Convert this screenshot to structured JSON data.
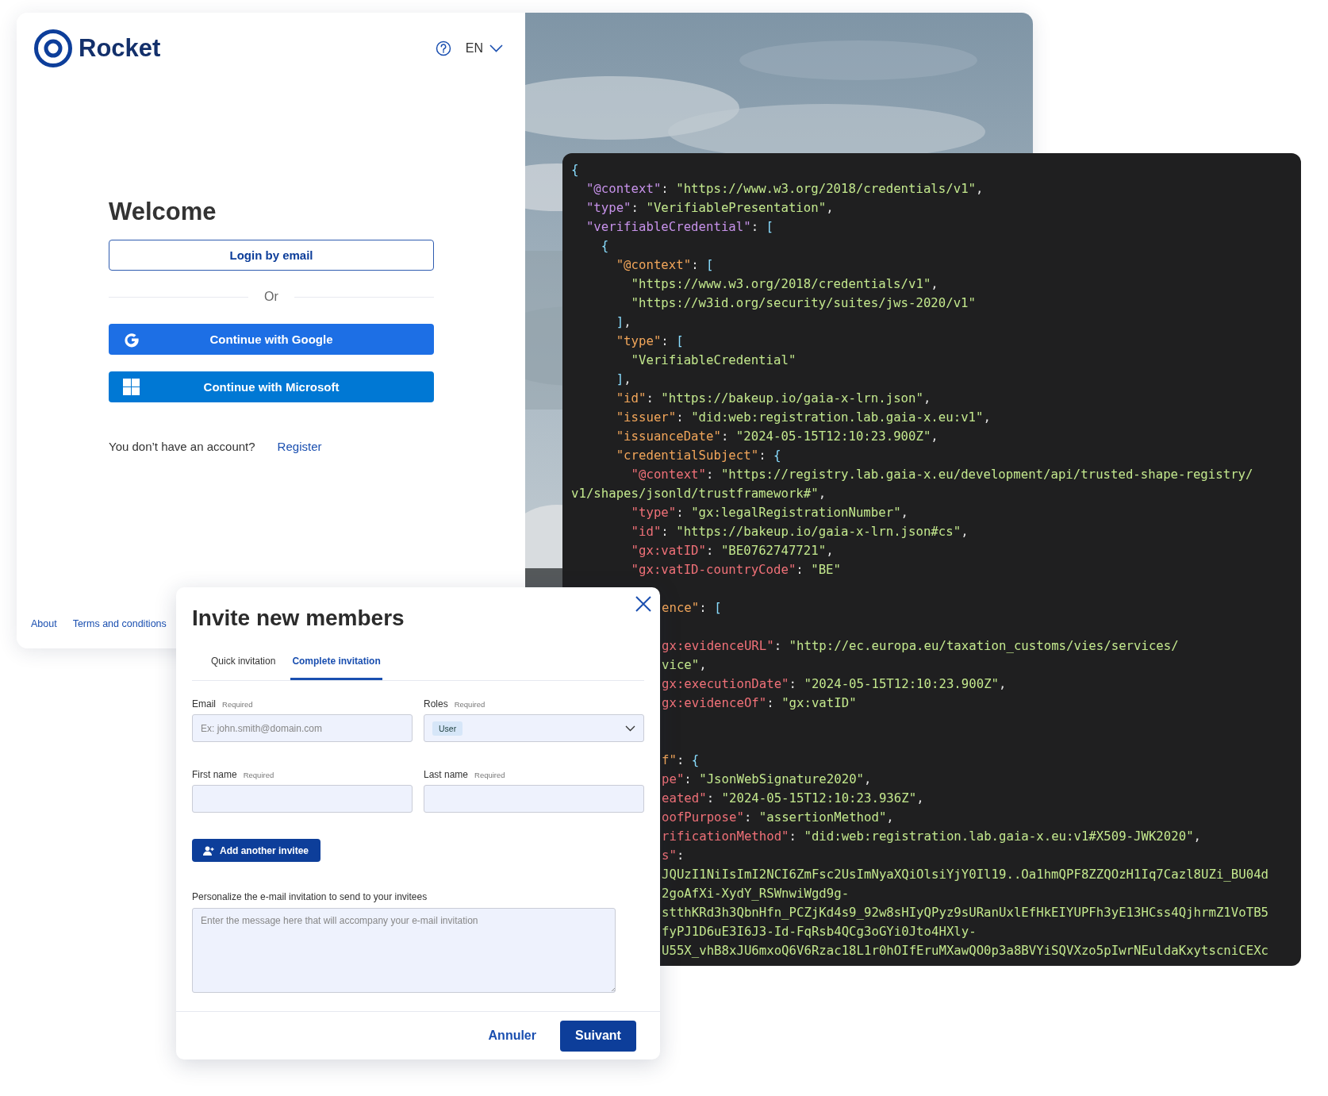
{
  "login": {
    "brand": "Rocket",
    "language": "EN",
    "title": "Welcome",
    "email_button": "Login by email",
    "divider": "Or",
    "providers": [
      {
        "kind": "google",
        "label": "Continue with Google"
      },
      {
        "kind": "microsoft",
        "label": "Continue with Microsoft"
      }
    ],
    "register_prompt": "You don’t have an account?",
    "register_link": "Register",
    "footer_links": [
      "About",
      "Terms and conditions"
    ],
    "background": {
      "kind": "picture"
    }
  },
  "code": {
    "lines": [
      {
        "kind": "text",
        "tokens": [
          {
            "text": "{",
            "color": "#89ddff"
          }
        ]
      },
      {
        "kind": "text",
        "tokens": [
          {
            "text": "  \"@context\"",
            "color": "#c792ea"
          },
          {
            "text": ": ",
            "color": "#e4e4e4"
          },
          {
            "text": "\"https://www.w3.org/2018/credentials/v1\"",
            "color": "#c3e88d"
          },
          {
            "text": ",",
            "color": "#e4e4e4"
          }
        ]
      },
      {
        "kind": "text",
        "tokens": [
          {
            "text": "  \"type\"",
            "color": "#c792ea"
          },
          {
            "text": ": ",
            "color": "#e4e4e4"
          },
          {
            "text": "\"VerifiablePresentation\"",
            "color": "#c3e88d"
          },
          {
            "text": ",",
            "color": "#e4e4e4"
          }
        ]
      },
      {
        "kind": "text",
        "tokens": [
          {
            "text": "  \"verifiableCredential\"",
            "color": "#c792ea"
          },
          {
            "text": ": ",
            "color": "#e4e4e4"
          },
          {
            "text": "[",
            "color": "#89ddff"
          }
        ]
      },
      {
        "kind": "text",
        "tokens": [
          {
            "text": "    {",
            "color": "#89ddff"
          }
        ]
      },
      {
        "kind": "text",
        "tokens": [
          {
            "text": "      \"@context\"",
            "color": "#f2a65a"
          },
          {
            "text": ": ",
            "color": "#e4e4e4"
          },
          {
            "text": "[",
            "color": "#89ddff"
          }
        ]
      },
      {
        "kind": "text",
        "tokens": [
          {
            "text": "        \"https://www.w3.org/2018/credentials/v1\"",
            "color": "#c3e88d"
          },
          {
            "text": ",",
            "color": "#e4e4e4"
          }
        ]
      },
      {
        "kind": "text",
        "tokens": [
          {
            "text": "        \"https://w3id.org/security/suites/jws-2020/v1\"",
            "color": "#c3e88d"
          }
        ]
      },
      {
        "kind": "text",
        "tokens": [
          {
            "text": "      ]",
            "color": "#89ddff"
          },
          {
            "text": ",",
            "color": "#e4e4e4"
          }
        ]
      },
      {
        "kind": "text",
        "tokens": [
          {
            "text": "      \"type\"",
            "color": "#f2a65a"
          },
          {
            "text": ": ",
            "color": "#e4e4e4"
          },
          {
            "text": "[",
            "color": "#89ddff"
          }
        ]
      },
      {
        "kind": "text",
        "tokens": [
          {
            "text": "        \"VerifiableCredential\"",
            "color": "#c3e88d"
          }
        ]
      },
      {
        "kind": "text",
        "tokens": [
          {
            "text": "      ]",
            "color": "#89ddff"
          },
          {
            "text": ",",
            "color": "#e4e4e4"
          }
        ]
      },
      {
        "kind": "text",
        "tokens": [
          {
            "text": "      \"id\"",
            "color": "#f2a65a"
          },
          {
            "text": ": ",
            "color": "#e4e4e4"
          },
          {
            "text": "\"https://bakeup.io/gaia-x-lrn.json\"",
            "color": "#c3e88d"
          },
          {
            "text": ",",
            "color": "#e4e4e4"
          }
        ]
      },
      {
        "kind": "text",
        "tokens": [
          {
            "text": "      \"issuer\"",
            "color": "#f2a65a"
          },
          {
            "text": ": ",
            "color": "#e4e4e4"
          },
          {
            "text": "\"did:web:registration.lab.gaia-x.eu:v1\"",
            "color": "#c3e88d"
          },
          {
            "text": ",",
            "color": "#e4e4e4"
          }
        ]
      },
      {
        "kind": "text",
        "tokens": [
          {
            "text": "      \"issuanceDate\"",
            "color": "#f2a65a"
          },
          {
            "text": ": ",
            "color": "#e4e4e4"
          },
          {
            "text": "\"2024-05-15T12:10:23.900Z\"",
            "color": "#c3e88d"
          },
          {
            "text": ",",
            "color": "#e4e4e4"
          }
        ]
      },
      {
        "kind": "text",
        "tokens": [
          {
            "text": "      \"credentialSubject\"",
            "color": "#f2a65a"
          },
          {
            "text": ": ",
            "color": "#e4e4e4"
          },
          {
            "text": "{",
            "color": "#89ddff"
          }
        ]
      },
      {
        "kind": "text",
        "tokens": [
          {
            "text": "        \"@context\"",
            "color": "#f07178"
          },
          {
            "text": ": ",
            "color": "#e4e4e4"
          },
          {
            "text": "\"https://registry.lab.gaia-x.eu/development/api/trusted-shape-registry/",
            "color": "#c3e88d"
          }
        ]
      },
      {
        "kind": "text",
        "tokens": [
          {
            "text": "v1/shapes/jsonld/trustframework#\"",
            "color": "#c3e88d"
          },
          {
            "text": ",",
            "color": "#e4e4e4"
          }
        ]
      },
      {
        "kind": "text",
        "tokens": [
          {
            "text": "        \"type\"",
            "color": "#f07178"
          },
          {
            "text": ": ",
            "color": "#e4e4e4"
          },
          {
            "text": "\"gx:legalRegistrationNumber\"",
            "color": "#c3e88d"
          },
          {
            "text": ",",
            "color": "#e4e4e4"
          }
        ]
      },
      {
        "kind": "text",
        "tokens": [
          {
            "text": "        \"id\"",
            "color": "#f07178"
          },
          {
            "text": ": ",
            "color": "#e4e4e4"
          },
          {
            "text": "\"https://bakeup.io/gaia-x-lrn.json#cs\"",
            "color": "#c3e88d"
          },
          {
            "text": ",",
            "color": "#e4e4e4"
          }
        ]
      },
      {
        "kind": "text",
        "tokens": [
          {
            "text": "        \"gx:vatID\"",
            "color": "#f07178"
          },
          {
            "text": ": ",
            "color": "#e4e4e4"
          },
          {
            "text": "\"BE0762747721\"",
            "color": "#c3e88d"
          },
          {
            "text": ",",
            "color": "#e4e4e4"
          }
        ]
      },
      {
        "kind": "text",
        "tokens": [
          {
            "text": "        \"gx:vatID-countryCode\"",
            "color": "#f07178"
          },
          {
            "text": ": ",
            "color": "#e4e4e4"
          },
          {
            "text": "\"BE\"",
            "color": "#c3e88d"
          }
        ]
      },
      {
        "kind": "covered"
      },
      {
        "kind": "cut",
        "tokens": [
          {
            "text": "ence\"",
            "color": "#f2a65a"
          },
          {
            "text": ": ",
            "color": "#e4e4e4"
          },
          {
            "text": "[",
            "color": "#89ddff"
          }
        ]
      },
      {
        "kind": "covered"
      },
      {
        "kind": "cut",
        "tokens": [
          {
            "text": "gx:evidenceURL\"",
            "color": "#f07178"
          },
          {
            "text": ": ",
            "color": "#e4e4e4"
          },
          {
            "text": "\"http://ec.europa.eu/taxation_customs/vies/services/",
            "color": "#c3e88d"
          }
        ]
      },
      {
        "kind": "cut",
        "tokens": [
          {
            "text": "vice\"",
            "color": "#c3e88d"
          },
          {
            "text": ",",
            "color": "#e4e4e4"
          }
        ]
      },
      {
        "kind": "cut",
        "tokens": [
          {
            "text": "gx:executionDate\"",
            "color": "#f07178"
          },
          {
            "text": ": ",
            "color": "#e4e4e4"
          },
          {
            "text": "\"2024-05-15T12:10:23.900Z\"",
            "color": "#c3e88d"
          },
          {
            "text": ",",
            "color": "#e4e4e4"
          }
        ]
      },
      {
        "kind": "cut",
        "tokens": [
          {
            "text": "gx:evidenceOf\"",
            "color": "#f07178"
          },
          {
            "text": ": ",
            "color": "#e4e4e4"
          },
          {
            "text": "\"gx:vatID\"",
            "color": "#c3e88d"
          }
        ]
      },
      {
        "kind": "covered"
      },
      {
        "kind": "covered"
      },
      {
        "kind": "cut",
        "tokens": [
          {
            "text": "f\"",
            "color": "#f2a65a"
          },
          {
            "text": ": ",
            "color": "#e4e4e4"
          },
          {
            "text": "{",
            "color": "#89ddff"
          }
        ]
      },
      {
        "kind": "cut",
        "tokens": [
          {
            "text": "pe\"",
            "color": "#f07178"
          },
          {
            "text": ": ",
            "color": "#e4e4e4"
          },
          {
            "text": "\"JsonWebSignature2020\"",
            "color": "#c3e88d"
          },
          {
            "text": ",",
            "color": "#e4e4e4"
          }
        ]
      },
      {
        "kind": "cut",
        "tokens": [
          {
            "text": "eated\"",
            "color": "#f07178"
          },
          {
            "text": ": ",
            "color": "#e4e4e4"
          },
          {
            "text": "\"2024-05-15T12:10:23.936Z\"",
            "color": "#c3e88d"
          },
          {
            "text": ",",
            "color": "#e4e4e4"
          }
        ]
      },
      {
        "kind": "cut",
        "tokens": [
          {
            "text": "oofPurpose\"",
            "color": "#f07178"
          },
          {
            "text": ": ",
            "color": "#e4e4e4"
          },
          {
            "text": "\"assertionMethod\"",
            "color": "#c3e88d"
          },
          {
            "text": ",",
            "color": "#e4e4e4"
          }
        ]
      },
      {
        "kind": "cut",
        "tokens": [
          {
            "text": "rificationMethod\"",
            "color": "#f07178"
          },
          {
            "text": ": ",
            "color": "#e4e4e4"
          },
          {
            "text": "\"did:web:registration.lab.gaia-x.eu:v1#X509-JWK2020\"",
            "color": "#c3e88d"
          },
          {
            "text": ",",
            "color": "#e4e4e4"
          }
        ]
      },
      {
        "kind": "cut",
        "tokens": [
          {
            "text": "s\"",
            "color": "#f07178"
          },
          {
            "text": ":",
            "color": "#e4e4e4"
          }
        ]
      },
      {
        "kind": "cut",
        "tokens": [
          {
            "text": "JQUzI1NiIsImI2NCI6ZmFsc2UsImNyaXQiOlsiYjY0Il19..Oa1hmQPF8ZZQOzH1Iq7Cazl8UZi_BU04d",
            "color": "#c3e88d"
          }
        ]
      },
      {
        "kind": "cut",
        "tokens": [
          {
            "text": "2goAfXi-XydY_RSWnwiWgd9g-",
            "color": "#c3e88d"
          }
        ]
      },
      {
        "kind": "cut",
        "tokens": [
          {
            "text": "stthKRd3h3QbnHfn_PCZjKd4s9_92w8sHIyQPyz9sURanUxlEfHkEIYUPFh3yE13HCss4QjhrmZ1VoTB5",
            "color": "#c3e88d"
          }
        ]
      },
      {
        "kind": "cut",
        "tokens": [
          {
            "text": "fyPJ1D6uE3I6J3-Id-FqRsb4QCg3oGYi0Jto4HXly-",
            "color": "#c3e88d"
          }
        ]
      },
      {
        "kind": "cut",
        "tokens": [
          {
            "text": "U55X_vhB8xJU6mxoQ6V6Rzac18L1r0hOIfEruMXawQO0p3a8BVYiSQVXzo5pIwrNEuldaKxytscniCEXc",
            "color": "#c3e88d"
          }
        ]
      }
    ]
  },
  "invite": {
    "title": "Invite new members",
    "tabs": [
      {
        "label": "Quick invitation",
        "selected": false
      },
      {
        "label": "Complete invitation",
        "selected": true
      }
    ],
    "fields": [
      {
        "kind": "text",
        "label": "Email",
        "note": "Required",
        "placeholder": "Ex: john.smith@domain.com"
      },
      {
        "kind": "select",
        "label": "Roles",
        "note": "Required",
        "chips": [
          "User"
        ]
      },
      {
        "kind": "text",
        "label": "First name",
        "note": "Required"
      },
      {
        "kind": "text",
        "label": "Last name",
        "note": "Required"
      }
    ],
    "add_button": "Add another invitee",
    "message": {
      "label": "Personalize the e-mail invitation to send to your invitees",
      "placeholder": "Enter the message here that will accompany your e-mail invitation"
    },
    "buttons": [
      {
        "kind": "secondary",
        "label": "Annuler"
      },
      {
        "kind": "primary",
        "label": "Suivant"
      }
    ]
  }
}
